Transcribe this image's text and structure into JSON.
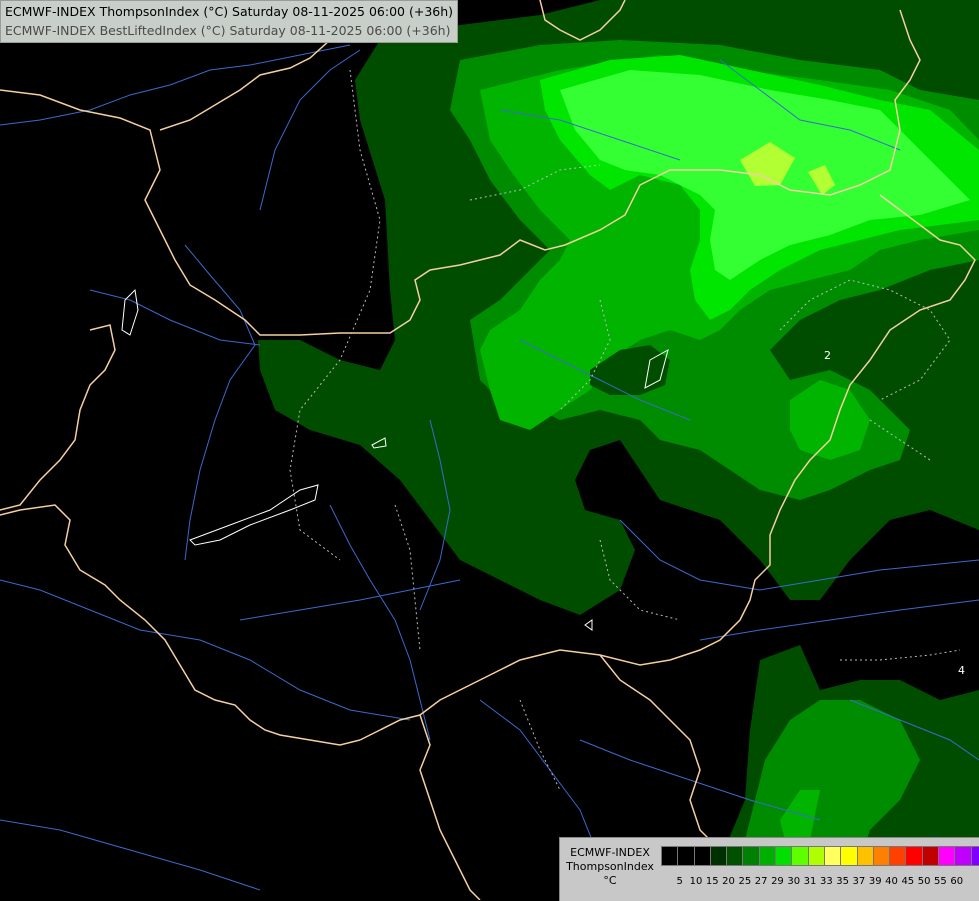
{
  "header": {
    "line1": "ECMWF-INDEX ThompsonIndex (°C) Saturday 08-11-2025 06:00 (+36h)",
    "line2": "ECMWF-INDEX BestLiftedIndex (°C) Saturday 08-11-2025 06:00 (+36h)"
  },
  "legend": {
    "title_line1": "ECMWF-INDEX",
    "title_line2": "ThompsonIndex",
    "title_line3": "°C",
    "colors": [
      "#000000",
      "#000000",
      "#000000",
      "#003000",
      "#005000",
      "#008000",
      "#00b000",
      "#00e000",
      "#60ff00",
      "#b0ff00",
      "#ffff60",
      "#ffff00",
      "#ffc000",
      "#ff8000",
      "#ff4000",
      "#ff0000",
      "#c00000",
      "#ff00ff",
      "#c000ff",
      "#8000ff",
      "#4000ff",
      "#0000ff"
    ],
    "ticks": [
      "5",
      "10",
      "15",
      "20",
      "25",
      "27",
      "29",
      "30",
      "31",
      "33",
      "35",
      "37",
      "39",
      "40",
      "45",
      "50",
      "55",
      "60"
    ]
  },
  "contour_labels": [
    "2",
    "4"
  ],
  "colors": {
    "shade_20": "#004d00",
    "shade_25": "#008c00",
    "shade_27": "#00b400",
    "shade_29": "#00e600",
    "shade_30": "#33ff33",
    "shade_31": "#b2ff33",
    "borders": "#f5cfa0",
    "rivers": "#3a6acc"
  }
}
